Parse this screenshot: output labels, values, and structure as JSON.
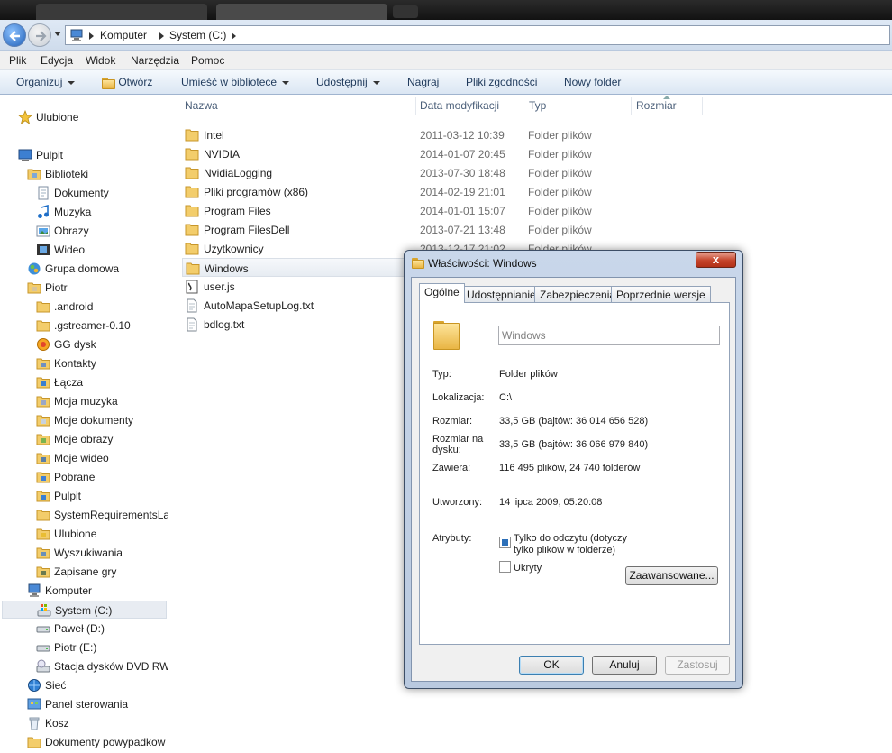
{
  "address": {
    "crumbs": [
      "Komputer",
      "System (C:)"
    ]
  },
  "menu": [
    "Plik",
    "Edycja",
    "Widok",
    "Narzędzia",
    "Pomoc"
  ],
  "commands": [
    {
      "label": "Organizuj",
      "dropdown": true
    },
    {
      "label": "Otwórz",
      "dropdown": false
    },
    {
      "label": "Umieść w bibliotece",
      "dropdown": true
    },
    {
      "label": "Udostępnij",
      "dropdown": true
    },
    {
      "label": "Nagraj",
      "dropdown": false
    },
    {
      "label": "Pliki zgodności",
      "dropdown": false
    },
    {
      "label": "Nowy folder",
      "dropdown": false
    }
  ],
  "nav": [
    {
      "label": "Ulubione",
      "icon": "star-icon"
    },
    {
      "label": "Pulpit",
      "icon": "desktop-icon"
    },
    {
      "label": "Biblioteki",
      "icon": "libraries-icon"
    },
    {
      "label": "Dokumenty",
      "icon": "documents-icon"
    },
    {
      "label": "Muzyka",
      "icon": "music-icon"
    },
    {
      "label": "Obrazy",
      "icon": "pictures-icon"
    },
    {
      "label": "Wideo",
      "icon": "video-icon"
    },
    {
      "label": "Grupa domowa",
      "icon": "homegroup-icon"
    },
    {
      "label": "Piotr",
      "icon": "user-folder-icon"
    },
    {
      "label": ".android",
      "icon": "folder-icon"
    },
    {
      "label": ".gstreamer-0.10",
      "icon": "folder-icon"
    },
    {
      "label": "GG dysk",
      "icon": "gg-disk-icon"
    },
    {
      "label": "Kontakty",
      "icon": "contacts-icon"
    },
    {
      "label": "Łącza",
      "icon": "links-icon"
    },
    {
      "label": "Moja muzyka",
      "icon": "music-folder-icon"
    },
    {
      "label": "Moje dokumenty",
      "icon": "documents-folder-icon"
    },
    {
      "label": "Moje obrazy",
      "icon": "pictures-folder-icon"
    },
    {
      "label": "Moje wideo",
      "icon": "video-folder-icon"
    },
    {
      "label": "Pobrane",
      "icon": "downloads-icon"
    },
    {
      "label": "Pulpit",
      "icon": "desktop-folder-icon"
    },
    {
      "label": "SystemRequirementsLa",
      "icon": "folder-icon"
    },
    {
      "label": "Ulubione",
      "icon": "favorites-folder-icon"
    },
    {
      "label": "Wyszukiwania",
      "icon": "searches-icon"
    },
    {
      "label": "Zapisane gry",
      "icon": "saved-games-icon"
    },
    {
      "label": "Komputer",
      "icon": "computer-icon"
    },
    {
      "label": "System (C:)",
      "icon": "system-drive-icon"
    },
    {
      "label": "Paweł (D:)",
      "icon": "drive-icon"
    },
    {
      "label": "Piotr (E:)",
      "icon": "drive-icon"
    },
    {
      "label": "Stacja dysków DVD RW",
      "icon": "dvd-drive-icon"
    },
    {
      "label": "Sieć",
      "icon": "network-icon"
    },
    {
      "label": "Panel sterowania",
      "icon": "control-panel-icon"
    },
    {
      "label": "Kosz",
      "icon": "recycle-bin-icon"
    },
    {
      "label": "Dokumenty powypadkow",
      "icon": "folder-icon"
    }
  ],
  "columns": {
    "name": "Nazwa",
    "date": "Data modyfikacji",
    "type": "Typ",
    "size": "Rozmiar"
  },
  "files": [
    {
      "name": "Intel",
      "date": "2011-03-12 10:39",
      "type": "Folder plików",
      "icon": "folder-icon"
    },
    {
      "name": "NVIDIA",
      "date": "2014-01-07 20:45",
      "type": "Folder plików",
      "icon": "folder-icon"
    },
    {
      "name": "NvidiaLogging",
      "date": "2013-07-30 18:48",
      "type": "Folder plików",
      "icon": "folder-icon"
    },
    {
      "name": "Pliki programów (x86)",
      "date": "2014-02-19 21:01",
      "type": "Folder plików",
      "icon": "folder-icon"
    },
    {
      "name": "Program Files",
      "date": "2014-01-01 15:07",
      "type": "Folder plików",
      "icon": "folder-icon"
    },
    {
      "name": "Program FilesDell",
      "date": "2013-07-21 13:48",
      "type": "Folder plików",
      "icon": "folder-icon"
    },
    {
      "name": "Użytkownicy",
      "date": "2013-12-17 21:02",
      "type": "Folder plików",
      "icon": "folder-icon"
    },
    {
      "name": "Windows",
      "date": "",
      "type": "",
      "icon": "folder-icon"
    },
    {
      "name": "user.js",
      "date": "",
      "type": "",
      "icon": "script-file-icon"
    },
    {
      "name": "AutoMapaSetupLog.txt",
      "date": "",
      "type": "",
      "icon": "text-file-icon"
    },
    {
      "name": "bdlog.txt",
      "date": "",
      "type": "",
      "icon": "text-file-icon"
    }
  ],
  "dialog": {
    "title": "Właściwości: Windows",
    "close_glyph": "x",
    "tabs": [
      "Ogólne",
      "Udostępnianie",
      "Zabezpieczenia",
      "Poprzednie wersje"
    ],
    "folder_name": "Windows",
    "props": {
      "type_label": "Typ:",
      "type_value": "Folder plików",
      "location_label": "Lokalizacja:",
      "location_value": "C:\\",
      "size_label": "Rozmiar:",
      "size_value": "33,5 GB (bajtów: 36 014 656 528)",
      "disk_size_label_1": "Rozmiar na",
      "disk_size_label_2": "dysku:",
      "disk_size_value": "33,5 GB (bajtów: 36 066 979 840)",
      "contains_label": "Zawiera:",
      "contains_value": "116 495 plików, 24 740 folderów",
      "created_label": "Utworzony:",
      "created_value": "14 lipca 2009, 05:20:08",
      "attributes_label": "Atrybuty:",
      "readonly_label_1": "Tylko do odczytu (dotyczy",
      "readonly_label_2": "tylko plików w folderze)",
      "hidden_label": "Ukryty",
      "advanced_button": "Zaawansowane..."
    },
    "buttons": {
      "ok": "OK",
      "cancel": "Anuluj",
      "apply": "Zastosuj"
    }
  }
}
